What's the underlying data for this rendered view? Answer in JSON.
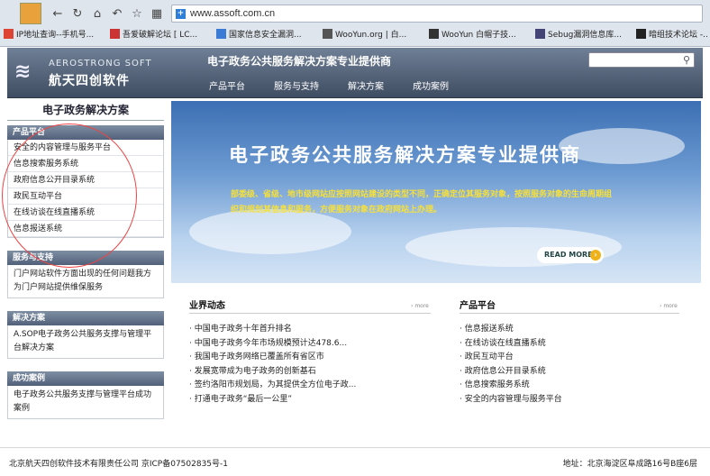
{
  "browser": {
    "url": "www.assoft.com.cn",
    "bookmarks": [
      {
        "label": "IP地址查询--手机号...",
        "icon": "red-book-icon",
        "color": "#d43"
      },
      {
        "label": "吾爱破解论坛 [ LC...",
        "icon": "puzzle-icon",
        "color": "#c33"
      },
      {
        "label": "国家信息安全漏洞...",
        "icon": "globe-icon",
        "color": "#3a7bd5"
      },
      {
        "label": "WooYun.org | 白...",
        "icon": "wooyun-icon",
        "color": "#555"
      },
      {
        "label": "WooYun 白帽子技...",
        "icon": "wooyun-icon",
        "color": "#333"
      },
      {
        "label": "Sebug漏洞信息库...",
        "icon": "sebug-icon",
        "color": "#447"
      },
      {
        "label": "暗组技术论坛 -...",
        "icon": "dark-icon",
        "color": "#222"
      }
    ]
  },
  "header": {
    "logo_en": "AEROSTRONG SOFT",
    "logo_cn": "航天四创软件",
    "title": "电子政务公共服务解决方案专业提供商",
    "nav": [
      "产品平台",
      "服务与支持",
      "解决方案",
      "成功案例"
    ],
    "search_placeholder": ""
  },
  "sidebar": {
    "heading": "电子政务解决方案",
    "products_title": "产品平台",
    "products": [
      "安全的内容管理与服务平台",
      "信息搜索服务系统",
      "政府信息公开目录系统",
      "政民互动平台",
      "在线访谈在线直播系统",
      "信息报送系统"
    ],
    "service_title": "服务与支持",
    "service_text": "门户网站软件方面出现的任何问题我方为门户网站提供维保服务",
    "solution_title": "解决方案",
    "solution_text": "A.SOP电子政务公共服务支撑与管理平台解决方案",
    "cases_title": "成功案例",
    "cases_text": "电子政务公共服务支撑与管理平台成功案例"
  },
  "banner": {
    "title": "电子政务公共服务解决方案专业提供商",
    "desc": "部委级、省级、地市级网站应按照网站建设的类型不同，正确定位其服务对象，按照服务对象的生命周期组织和规划其信息和服务，方便服务对象在政府网站上办理。",
    "read_more": "READ MORE"
  },
  "news": {
    "title": "业界动态",
    "more": "more",
    "items": [
      "中国电子政务十年首升排名",
      "中国电子政务今年市场规模预计达478.6...",
      "我国电子政务网络已覆盖所有省区市",
      "发展宽带成为电子政务的创新基石",
      "签约洛阳市规划局，为其提供全方位电子政...",
      "打通电子政务“最后一公里”"
    ]
  },
  "products_panel": {
    "title": "产品平台",
    "more": "more",
    "items": [
      "信息报送系统",
      "在线访谈在线直播系统",
      "政民互动平台",
      "政府信息公开目录系统",
      "信息搜索服务系统",
      "安全的内容管理与服务平台"
    ]
  },
  "footer": {
    "company": "北京航天四创软件技术有限责任公司 京ICP备07502835号-1",
    "address": "地址：北京海淀区阜成路16号B座6层"
  }
}
